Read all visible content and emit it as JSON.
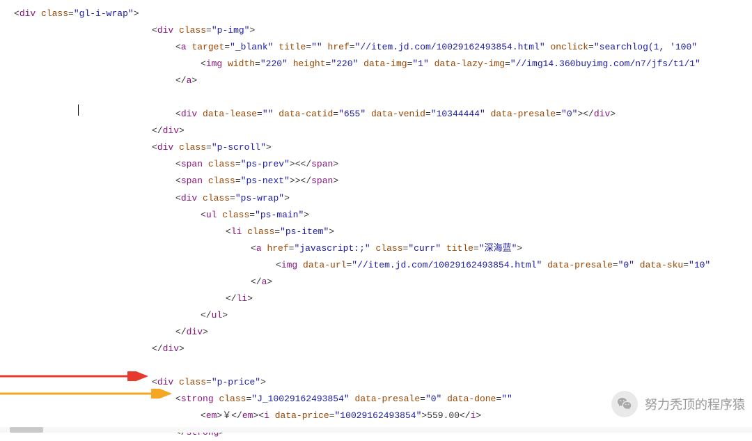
{
  "code": {
    "l1": {
      "ind": "i1",
      "tag_open": "<",
      "tag": "div",
      "attrs": [
        {
          "n": "class",
          "v": "gl-i-wrap"
        }
      ],
      "text": "",
      "close": ">"
    },
    "l2": {
      "ind": "i2",
      "tag_open": "<",
      "tag": "div",
      "attrs": [
        {
          "n": "class",
          "v": "p-img"
        }
      ],
      "text": "",
      "close": ">"
    },
    "l3": {
      "ind": "i3",
      "tag_open": "<",
      "tag": "a",
      "attrs": [
        {
          "n": "target",
          "v": "_blank"
        },
        {
          "n": "title",
          "v": ""
        },
        {
          "n": "href",
          "v": "//item.jd.com/10029162493854.html"
        },
        {
          "n": "onclick",
          "v": "searchlog(1, '100"
        }
      ],
      "text": "",
      "close": ""
    },
    "l4": {
      "ind": "i4",
      "tag_open": "<",
      "tag": "img",
      "attrs": [
        {
          "n": "width",
          "v": "220"
        },
        {
          "n": "height",
          "v": "220"
        },
        {
          "n": "data-img",
          "v": "1"
        },
        {
          "n": "data-lazy-img",
          "v": "//img14.360buyimg.com/n7/jfs/t1/1"
        }
      ],
      "text": "",
      "close": ""
    },
    "l5": {
      "ind": "i3",
      "tag_open": "</",
      "tag": "a",
      "attrs": [],
      "text": "",
      "close": ">"
    },
    "l6": {
      "ind": "i3",
      "tag_open": "<",
      "tag": "div",
      "attrs": [
        {
          "n": "data-lease",
          "v": ""
        },
        {
          "n": "data-catid",
          "v": "655"
        },
        {
          "n": "data-venid",
          "v": "10344444"
        },
        {
          "n": "data-presale",
          "v": "0"
        }
      ],
      "text": "",
      "close": "></div>"
    },
    "l7": {
      "ind": "i2",
      "tag_open": "</",
      "tag": "div",
      "attrs": [],
      "text": "",
      "close": ">"
    },
    "l8": {
      "ind": "i2",
      "tag_open": "<",
      "tag": "div",
      "attrs": [
        {
          "n": "class",
          "v": "p-scroll"
        }
      ],
      "text": "",
      "close": ">"
    },
    "l9": {
      "ind": "i3",
      "tag_open": "<",
      "tag": "span",
      "attrs": [
        {
          "n": "class",
          "v": "ps-prev"
        }
      ],
      "text": "&lt;",
      "close": "></span>"
    },
    "l10": {
      "ind": "i3",
      "tag_open": "<",
      "tag": "span",
      "attrs": [
        {
          "n": "class",
          "v": "ps-next"
        }
      ],
      "text": "&gt;",
      "close": "></span>"
    },
    "l11": {
      "ind": "i3",
      "tag_open": "<",
      "tag": "div",
      "attrs": [
        {
          "n": "class",
          "v": "ps-wrap"
        }
      ],
      "text": "",
      "close": ">"
    },
    "l12": {
      "ind": "i4",
      "tag_open": "<",
      "tag": "ul",
      "attrs": [
        {
          "n": "class",
          "v": "ps-main"
        }
      ],
      "text": "",
      "close": ">"
    },
    "l13": {
      "ind": "i5",
      "tag_open": "<",
      "tag": "li",
      "attrs": [
        {
          "n": "class",
          "v": "ps-item"
        }
      ],
      "text": "",
      "close": ">"
    },
    "l14": {
      "ind": "i6",
      "tag_open": "<",
      "tag": "a",
      "attrs": [
        {
          "n": "href",
          "v": "javascript:;"
        },
        {
          "n": "class",
          "v": "curr"
        },
        {
          "n": "title",
          "v": "深海蓝"
        }
      ],
      "text": "",
      "close": ">"
    },
    "l15": {
      "ind": "i7",
      "tag_open": "<",
      "tag": "img",
      "attrs": [
        {
          "n": "data-url",
          "v": "//item.jd.com/10029162493854.html"
        },
        {
          "n": "data-presale",
          "v": "0"
        },
        {
          "n": "data-sku",
          "v": "10"
        }
      ],
      "text": "",
      "close": ""
    },
    "l16": {
      "ind": "i6",
      "tag_open": "</",
      "tag": "a",
      "attrs": [],
      "text": "",
      "close": ">"
    },
    "l17": {
      "ind": "i5",
      "tag_open": "</",
      "tag": "li",
      "attrs": [],
      "text": "",
      "close": ">"
    },
    "l18": {
      "ind": "i4",
      "tag_open": "</",
      "tag": "ul",
      "attrs": [],
      "text": "",
      "close": ">"
    },
    "l19": {
      "ind": "i3",
      "tag_open": "</",
      "tag": "div",
      "attrs": [],
      "text": "",
      "close": ">"
    },
    "l20": {
      "ind": "i2",
      "tag_open": "</",
      "tag": "div",
      "attrs": [],
      "text": "",
      "close": ">"
    },
    "l21": {
      "ind": "i2",
      "tag_open": "<",
      "tag": "div",
      "attrs": [
        {
          "n": "class",
          "v": "p-price"
        }
      ],
      "text": "",
      "close": ">"
    },
    "l22": {
      "ind": "i3",
      "tag_open": "<",
      "tag": "strong",
      "attrs": [
        {
          "n": "class",
          "v": "J_10029162493854"
        },
        {
          "n": "data-presale",
          "v": "0"
        },
        {
          "n": "data-done",
          "v": "\""
        }
      ],
      "text": "",
      "close": ""
    },
    "l23_raw": "<em>￥</em><i data-price=\"10029162493854\">559.00</i>",
    "l24": {
      "ind": "i3",
      "tag_open": "</",
      "tag": "strong",
      "attrs": [],
      "text": "",
      "close": ">"
    }
  },
  "watermark": {
    "text": "努力秃顶的程序猿"
  },
  "arrows": {
    "red": "#e63a2e",
    "orange": "#f5a623"
  }
}
